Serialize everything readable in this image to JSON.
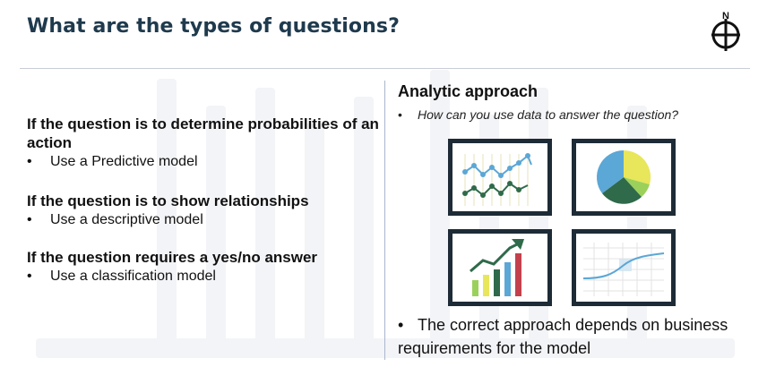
{
  "slide": {
    "title": "What are the types of questions?"
  },
  "left": {
    "groups": [
      {
        "question": "If the question is to determine probabilities of an action",
        "bullet": "Use a Predictive model"
      },
      {
        "question": "If the question is to show relationships",
        "bullet": "Use a descriptive model"
      },
      {
        "question": "If the question requires a yes/no answer",
        "bullet": "Use a classification model"
      }
    ]
  },
  "right": {
    "heading": "Analytic approach",
    "subtitle": "How can you use data to answer the question?",
    "note": "The correct approach depends on business requirements for the model"
  },
  "bullet_char": "•",
  "logo_letter": "N",
  "icons": [
    "line-chart-icon",
    "pie-chart-icon",
    "bar-growth-chart-icon",
    "curve-graph-icon"
  ],
  "colors": {
    "title": "#1f3a4d",
    "card_border": "#1d2b36",
    "divider": "#a9b6cc"
  }
}
